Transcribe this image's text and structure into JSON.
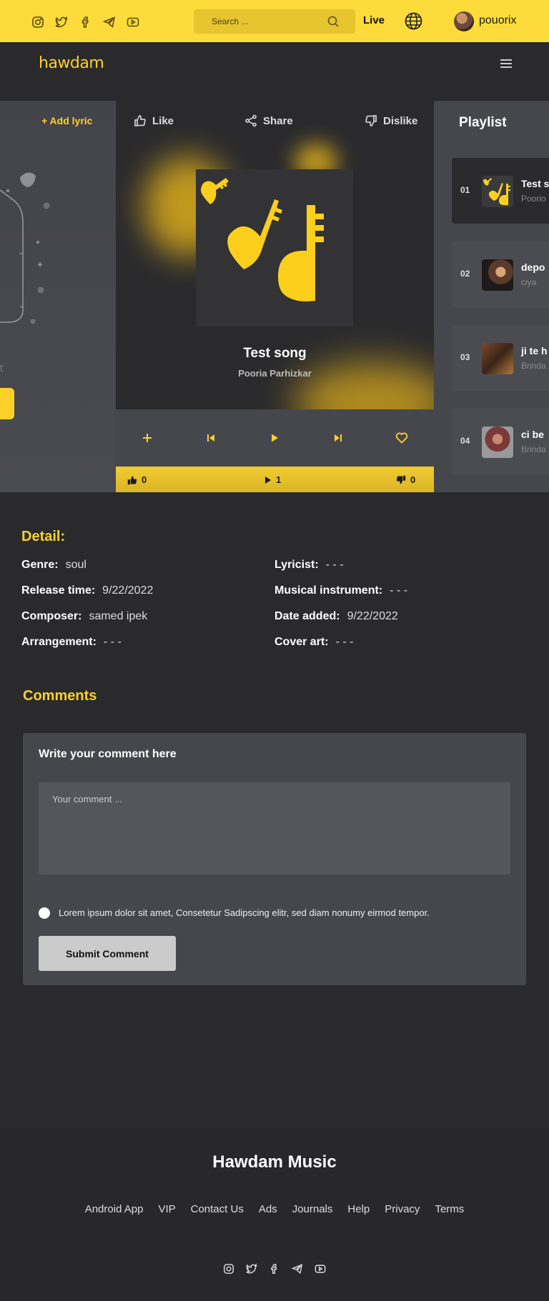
{
  "header": {
    "search_placeholder": "Search ...",
    "live_label": "Live",
    "username": "pouorix",
    "social_icons": [
      "instagram-icon",
      "twitter-icon",
      "facebook-icon",
      "telegram-icon",
      "youtube-icon"
    ]
  },
  "nav": {
    "logo_text": "hawdam"
  },
  "left_panel": {
    "add_lyric": "+ Add lyric",
    "partial_text": "t"
  },
  "player": {
    "like_label": "Like",
    "share_label": "Share",
    "dislike_label": "Dislike",
    "title": "Test song",
    "artist": "Pooria Parhizkar",
    "likes": "0",
    "plays": "1",
    "dislikes": "0"
  },
  "playlist": {
    "title": "Playlist",
    "items": [
      {
        "num": "01",
        "name": "Test s",
        "artist": "Poorio"
      },
      {
        "num": "02",
        "name": "depo",
        "artist": "ciya"
      },
      {
        "num": "03",
        "name": "ji te h",
        "artist": "Brinda"
      },
      {
        "num": "04",
        "name": "ci be",
        "artist": "Brinda"
      }
    ]
  },
  "detail": {
    "heading": "Detail:",
    "genre_label": "Genre:",
    "genre": "soul",
    "release_label": "Release time:",
    "release": "9/22/2022",
    "composer_label": "Composer:",
    "composer": "samed ipek",
    "arrangement_label": "Arrangement:",
    "arrangement": "- - -",
    "lyricist_label": "Lyricist:",
    "lyricist": "- - -",
    "instrument_label": "Musical instrument:",
    "instrument": "- - -",
    "date_added_label": "Date added:",
    "date_added": "9/22/2022",
    "cover_art_label": "Cover art:",
    "cover_art": "- - -"
  },
  "comments": {
    "heading": "Comments",
    "box_title": "Write your comment here",
    "placeholder": "Your comment ...",
    "consent": "Lorem ipsum dolor sit amet, Consetetur Sadipscing elitr, sed diam nonumy eirmod tempor.",
    "submit": "Submit Comment"
  },
  "footer": {
    "title": "Hawdam Music",
    "links": [
      "Android App",
      "VIP",
      "Contact Us",
      "Ads",
      "Journals",
      "Help",
      "Privacy",
      "Terms"
    ]
  },
  "colors": {
    "accent": "#fdd12a",
    "background": "#2a2a2c",
    "panel": "#46474d"
  }
}
